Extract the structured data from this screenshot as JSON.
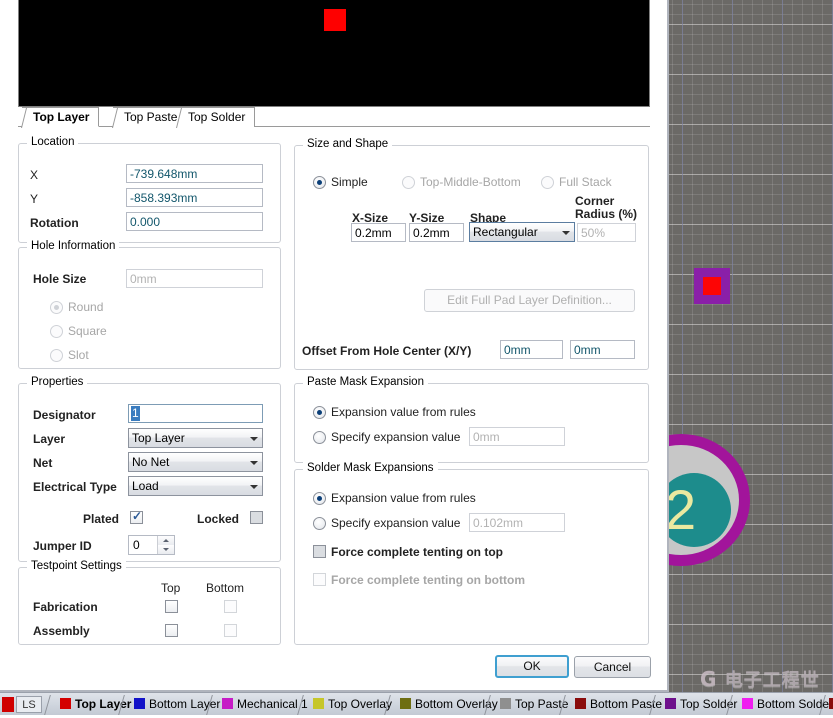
{
  "preview": {
    "name": "pad-preview",
    "background": "#000000",
    "pad_color": "#fe0000",
    "pad_shape": "Rectangular"
  },
  "layer_tabs": [
    {
      "label": "Top Layer",
      "selected": true
    },
    {
      "label": "Top Paste",
      "selected": false
    },
    {
      "label": "Top Solder",
      "selected": false
    }
  ],
  "location": {
    "title": "Location",
    "x_label": "X",
    "x_value": "-739.648mm",
    "y_label": "Y",
    "y_value": "-858.393mm",
    "rotation_label": "Rotation",
    "rotation_value": "0.000"
  },
  "hole_information": {
    "title": "Hole Information",
    "hole_size_label": "Hole Size",
    "hole_size_value": "0mm",
    "shapes": [
      {
        "label": "Round",
        "selected": true,
        "disabled": true
      },
      {
        "label": "Square",
        "selected": false,
        "disabled": true
      },
      {
        "label": "Slot",
        "selected": false,
        "disabled": true
      }
    ]
  },
  "properties": {
    "title": "Properties",
    "designator_label": "Designator",
    "designator_value": "1",
    "layer_label": "Layer",
    "layer_value": "Top Layer",
    "net_label": "Net",
    "net_value": "No Net",
    "electrical_type_label": "Electrical Type",
    "electrical_type_value": "Load",
    "plated_label": "Plated",
    "plated_checked": true,
    "locked_label": "Locked",
    "locked_checked": false,
    "jumper_id_label": "Jumper ID",
    "jumper_id_value": "0"
  },
  "testpoint_settings": {
    "title": "Testpoint Settings",
    "col_top": "Top",
    "col_bottom": "Bottom",
    "rows": [
      {
        "label": "Fabrication",
        "top": false,
        "bottom": false
      },
      {
        "label": "Assembly",
        "top": false,
        "bottom": false
      }
    ]
  },
  "size_and_shape": {
    "title": "Size and Shape",
    "modes": [
      {
        "label": "Simple",
        "selected": true,
        "disabled": false
      },
      {
        "label": "Top-Middle-Bottom",
        "selected": false,
        "disabled": true
      },
      {
        "label": "Full Stack",
        "selected": false,
        "disabled": true
      }
    ],
    "col_xsize": "X-Size",
    "col_ysize": "Y-Size",
    "col_shape": "Shape",
    "col_corner_radius_line1": "Corner",
    "col_corner_radius_line2": "Radius (%)",
    "xsize_value": "0.2mm",
    "ysize_value": "0.2mm",
    "shape_value": "Rectangular",
    "corner_radius_value": "50%",
    "edit_full_pad_button": "Edit Full Pad Layer Definition...",
    "offset_label": "Offset From Hole Center (X/Y)",
    "offset_x": "0mm",
    "offset_y": "0mm"
  },
  "paste_mask": {
    "title": "Paste Mask Expansion",
    "from_rules_label": "Expansion value from rules",
    "from_rules_selected": true,
    "specify_label": "Specify expansion value",
    "specify_selected": false,
    "specify_value": "0mm"
  },
  "solder_mask": {
    "title": "Solder Mask Expansions",
    "from_rules_label": "Expansion value from rules",
    "from_rules_selected": true,
    "specify_label": "Specify expansion value",
    "specify_selected": false,
    "specify_value": "0.102mm",
    "tent_top_label": "Force complete tenting on top",
    "tent_top_checked": false,
    "tent_bottom_label": "Force complete tenting on bottom",
    "tent_bottom_checked": false
  },
  "dialog_buttons": {
    "ok": "OK",
    "cancel": "Cancel"
  },
  "canvas": {
    "pad_round_label": "2",
    "watermark": "电子工程世界",
    "watermark_mark": "G"
  },
  "layer_bar": {
    "ls_label": "LS",
    "tabs": [
      {
        "label": "Top Layer",
        "color": "#d40000",
        "selected": true
      },
      {
        "label": "Bottom Layer",
        "color": "#1212c8",
        "selected": false
      },
      {
        "label": "Mechanical 1",
        "color": "#c61bc6",
        "selected": false
      },
      {
        "label": "Top Overlay",
        "color": "#c6c62a",
        "selected": false
      },
      {
        "label": "Bottom Overlay",
        "color": "#6e6e12",
        "selected": false
      },
      {
        "label": "Top Paste",
        "color": "#8f8f8f",
        "selected": false
      },
      {
        "label": "Bottom Paste",
        "color": "#8a0c0c",
        "selected": false
      },
      {
        "label": "Top Solder",
        "color": "#6e108c",
        "selected": false
      },
      {
        "label": "Bottom Solder",
        "color": "#f01ef0",
        "selected": false
      }
    ]
  }
}
